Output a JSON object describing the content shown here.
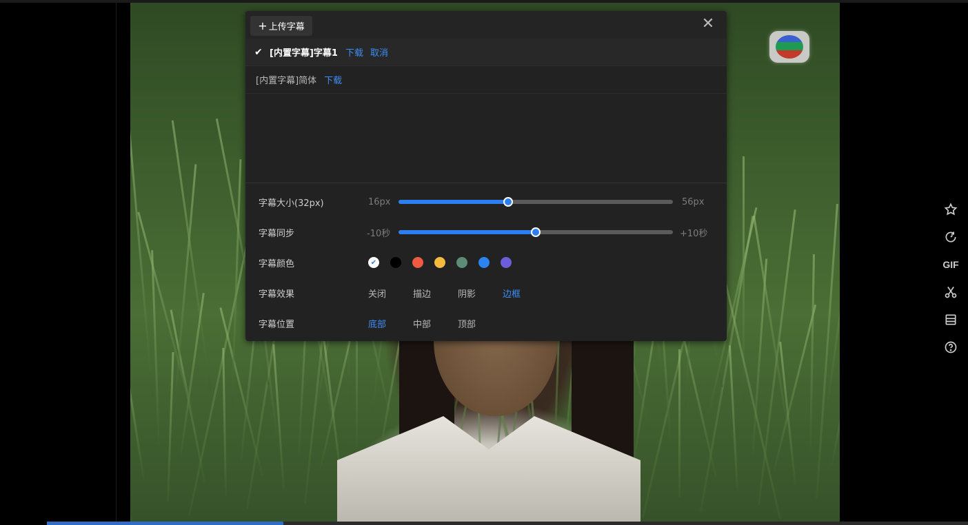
{
  "video": {
    "progress_fraction": 0.257
  },
  "panel": {
    "upload_label": "上传字幕",
    "close_icon": "close-icon",
    "tracks": [
      {
        "name": "[内置字幕]字幕1",
        "selected": true,
        "actions": [
          "下载",
          "取消"
        ]
      },
      {
        "name": "[内置字幕]简体",
        "selected": false,
        "actions": [
          "下载"
        ]
      }
    ],
    "size": {
      "label": "字幕大小(32px)",
      "min": "16px",
      "max": "56px",
      "value": 32,
      "range": [
        16,
        56
      ]
    },
    "sync": {
      "label": "字幕同步",
      "min": "-10秒",
      "max": "+10秒",
      "value": 0,
      "range": [
        -10,
        10
      ]
    },
    "color": {
      "label": "字幕颜色",
      "swatches": [
        "#ffffff",
        "#000000",
        "#ef5b42",
        "#f4bb3f",
        "#5e8b75",
        "#2b84f0",
        "#6c5ed8"
      ],
      "selected_index": 0
    },
    "effect": {
      "label": "字幕效果",
      "options": [
        "关闭",
        "描边",
        "阴影",
        "边框"
      ],
      "selected_index": 3
    },
    "position": {
      "label": "字幕位置",
      "options": [
        "底部",
        "中部",
        "顶部"
      ],
      "selected_index": 0
    }
  },
  "toolbar": {
    "items": [
      {
        "icon": "star-icon"
      },
      {
        "icon": "replay-icon"
      },
      {
        "label": "GIF"
      },
      {
        "icon": "scissors-icon"
      },
      {
        "icon": "list-icon"
      },
      {
        "icon": "help-icon"
      }
    ]
  },
  "accent_color": "#2d7ff0"
}
